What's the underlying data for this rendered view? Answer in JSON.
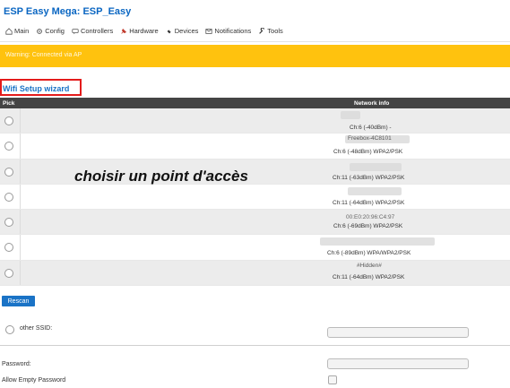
{
  "app": {
    "title": "ESP Easy Mega: ESP_Easy"
  },
  "menu": [
    {
      "label": "Main",
      "icon": "home-icon"
    },
    {
      "label": "Config",
      "icon": "gear-icon"
    },
    {
      "label": "Controllers",
      "icon": "chat-icon"
    },
    {
      "label": "Hardware",
      "icon": "pin-icon"
    },
    {
      "label": "Devices",
      "icon": "plug-icon"
    },
    {
      "label": "Notifications",
      "icon": "envelope-icon"
    },
    {
      "label": "Tools",
      "icon": "wrench-icon"
    }
  ],
  "banner": {
    "text": "Warning: Connected via AP"
  },
  "wizard": {
    "title": "Wifi Setup wizard"
  },
  "table": {
    "headers": {
      "pick": "Pick",
      "info": "Network info"
    },
    "rows": [
      {
        "lines": [
          "Ch:6 (-40dBm) -"
        ]
      },
      {
        "lines": [
          "Freebox-4C8101",
          "Ch:6 (-48dBm) WPA2/PSK"
        ]
      },
      {
        "lines": [
          "Ch:11 (-63dBm) WPA2/PSK"
        ]
      },
      {
        "lines": [
          "Ch:11 (-64dBm) WPA2/PSK"
        ]
      },
      {
        "lines": [
          "00:E0:20:96:C4:97",
          "Ch:6 (-69dBm) WPA2/PSK"
        ]
      },
      {
        "lines": [
          "Ch:6 (-89dBm) WPA/WPA2/PSK"
        ]
      },
      {
        "lines": [
          "#Hidden#",
          "Ch:11 (-64dBm) WPA2/PSK"
        ]
      }
    ]
  },
  "overlay": {
    "text": "choisir un point d'accès"
  },
  "rescan": {
    "label": "Rescan"
  },
  "form": {
    "other_ssid_label": "other SSID:",
    "password_label": "Password:",
    "allow_empty_label": "Allow Empty Password"
  }
}
